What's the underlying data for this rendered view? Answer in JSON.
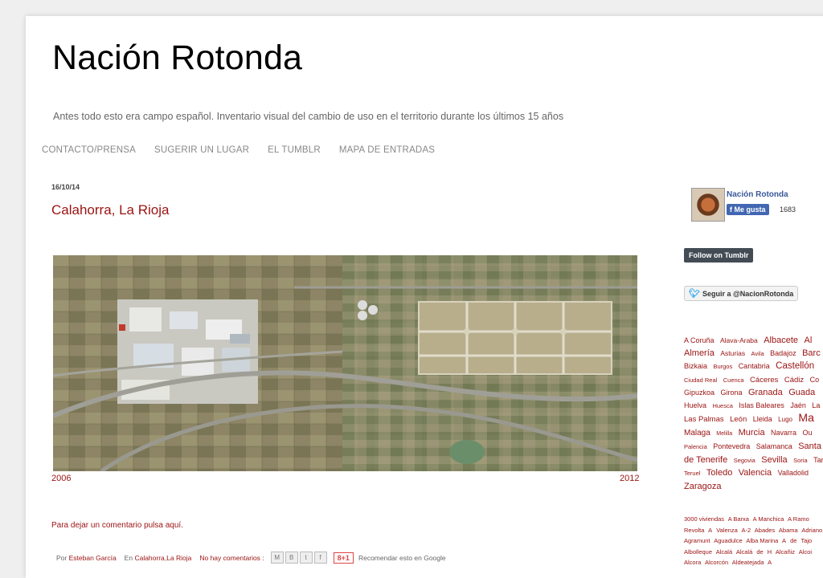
{
  "blog": {
    "title": "Nación Rotonda",
    "description": "Antes todo esto era campo español. Inventario visual del cambio de uso en el territorio durante los últimos 15 años"
  },
  "nav": [
    {
      "label": "CONTACTO/PRENSA"
    },
    {
      "label": "SUGERIR UN LUGAR"
    },
    {
      "label": "EL TUMBLR"
    },
    {
      "label": "MAPA DE ENTRADAS"
    }
  ],
  "post": {
    "date": "16/10/14",
    "title": "Calahorra, La Rioja",
    "year_left": "2006",
    "year_right": "2012",
    "comment_link": "Para dejar un comentario pulsa aquí.",
    "footer": {
      "by_label": "Por",
      "author": "Esteban García",
      "in_label": "En",
      "tag1": "Calahorra",
      "tag_sep": ",",
      "tag2": "La Rioja",
      "comments": "No hay comentarios :",
      "gplus": "8+1",
      "recommend": "Recomendar esto en Google"
    }
  },
  "sidebar": {
    "fb_name": "Nación Rotonda",
    "fb_like": "Me gusta",
    "fb_count": "1683",
    "tumblr": "Follow on Tumblr",
    "twitter": "Seguir a @NacionRotonda",
    "cloud_provinces": [
      {
        "t": "A Coruña",
        "s": 9
      },
      {
        "t": "Alava-Araba",
        "s": 8.5
      },
      {
        "t": "Albacete",
        "s": 11
      },
      {
        "t": "Al",
        "s": 11
      },
      {
        "t": "Almería",
        "s": 11
      },
      {
        "t": "Asturias",
        "s": 8.5
      },
      {
        "t": "Avila",
        "s": 7.5
      },
      {
        "t": "Badajoz",
        "s": 9
      },
      {
        "t": "Barc",
        "s": 11
      },
      {
        "t": "Bizkaia",
        "s": 9
      },
      {
        "t": "Burgos",
        "s": 7.5
      },
      {
        "t": "Cantabria",
        "s": 9
      },
      {
        "t": "Castellón",
        "s": 11.5
      },
      {
        "t": "Ciudad Real",
        "s": 7.5
      },
      {
        "t": "Cuenca",
        "s": 7.5
      },
      {
        "t": "Cáceres",
        "s": 9.5
      },
      {
        "t": "Cádiz",
        "s": 9.5
      },
      {
        "t": "Co",
        "s": 9
      },
      {
        "t": "Gipuzkoa",
        "s": 9
      },
      {
        "t": "Girona",
        "s": 9
      },
      {
        "t": "Granada",
        "s": 11
      },
      {
        "t": "Guada",
        "s": 11
      },
      {
        "t": "Huelva",
        "s": 9
      },
      {
        "t": "Huesca",
        "s": 7.5
      },
      {
        "t": "Islas Baleares",
        "s": 9
      },
      {
        "t": "Jaén",
        "s": 9
      },
      {
        "t": "La",
        "s": 9
      },
      {
        "t": "Las Palmas",
        "s": 9.5
      },
      {
        "t": "León",
        "s": 9.5
      },
      {
        "t": "Lleida",
        "s": 9
      },
      {
        "t": "Lugo",
        "s": 8
      },
      {
        "t": "Ma",
        "s": 14
      },
      {
        "t": "Malaga",
        "s": 10
      },
      {
        "t": "Melilla",
        "s": 7
      },
      {
        "t": "Murcia",
        "s": 11
      },
      {
        "t": "Navarra",
        "s": 9
      },
      {
        "t": "Ou",
        "s": 9
      },
      {
        "t": "Palencia",
        "s": 7.5
      },
      {
        "t": "Pontevedra",
        "s": 9
      },
      {
        "t": "Salamanca",
        "s": 9
      },
      {
        "t": "Santa",
        "s": 11
      },
      {
        "t": "de Tenerife",
        "s": 11
      },
      {
        "t": "Segovia",
        "s": 7.5
      },
      {
        "t": "Sevilla",
        "s": 11
      },
      {
        "t": "Soria",
        "s": 7.5
      },
      {
        "t": "Tarr",
        "s": 9
      },
      {
        "t": "Teruel",
        "s": 7.5
      },
      {
        "t": "Toledo",
        "s": 11
      },
      {
        "t": "Valencia",
        "s": 11
      },
      {
        "t": "Valladolid",
        "s": 9
      },
      {
        "t": "Zaragoza",
        "s": 11
      }
    ],
    "cloud_tags": [
      "3000 viviendas",
      "A Barxa",
      "A Manchica",
      "A Ramo",
      "Revolta",
      "A",
      "Valenza",
      "A-2",
      "Abades",
      "Abama",
      "Adriano",
      "Agramunt",
      "Aguadulce",
      "Alba Marina",
      "A",
      "de",
      "Tajo",
      "Albolleque",
      "Alcalá",
      "Alcalá",
      "de",
      "H",
      "Alcañiz",
      "Alcoi",
      "Alcora",
      "Alcorcón",
      "Aldeatejada",
      "A"
    ]
  }
}
